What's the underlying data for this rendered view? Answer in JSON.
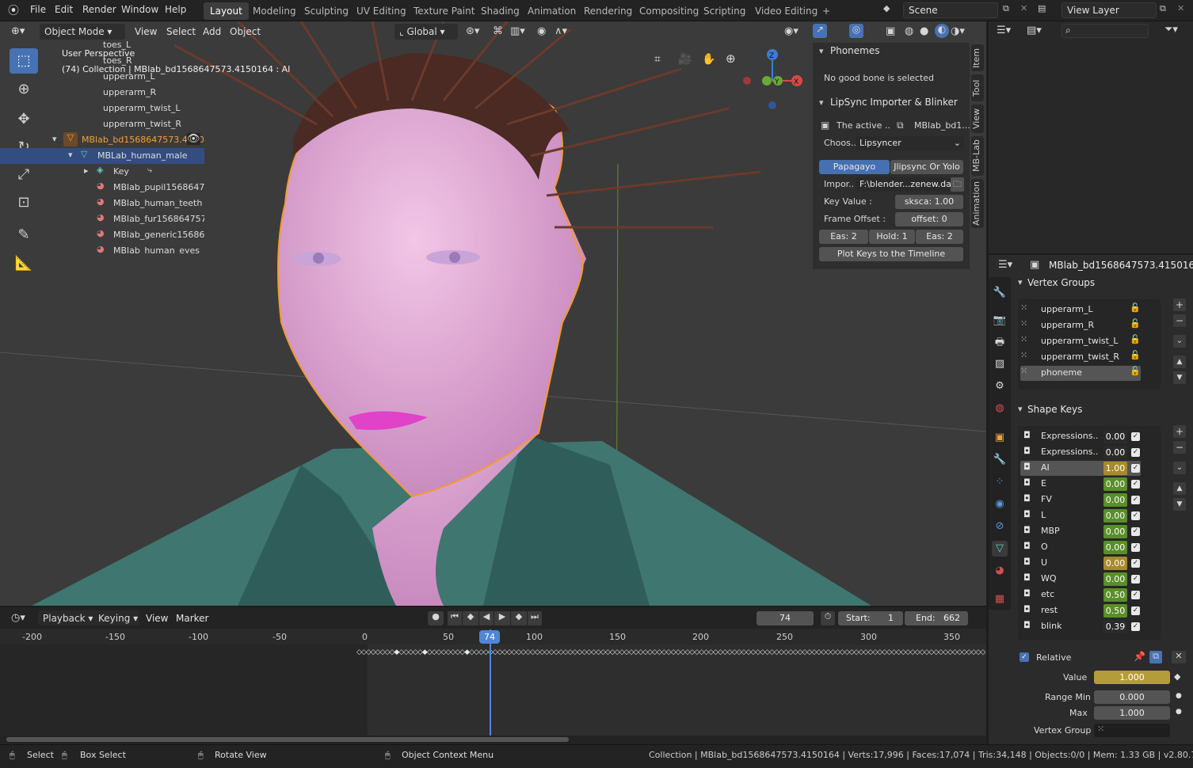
{
  "top_menu": {
    "items": [
      "File",
      "Edit",
      "Render",
      "Window",
      "Help"
    ],
    "workspaces": [
      "Layout",
      "Modeling",
      "Sculpting",
      "UV Editing",
      "Texture Paint",
      "Shading",
      "Animation",
      "Rendering",
      "Compositing",
      "Scripting",
      "Video Editing"
    ],
    "active_workspace": "Layout",
    "add_tab": "+",
    "scene": "Scene",
    "view_layer": "View Layer"
  },
  "viewport": {
    "mode": "Object Mode",
    "menus": [
      "View",
      "Select",
      "Add",
      "Object"
    ],
    "transform_orientation": "Global",
    "info_line1": "User Perspective",
    "info_line2": "(74) Collection | MBlab_bd1568647573.4150164 : AI",
    "gizmo": {
      "z": "Z",
      "y": "Y",
      "x": "X"
    }
  },
  "npanel": {
    "phonemes_title": "Phonemes",
    "phonemes_msg": "No good bone is selected",
    "lipsync_title": "LipSync Importer & Blinker",
    "active_label": "The active ..",
    "active_obj": "MBlab_bd1...",
    "choose_label": "Choos..",
    "choose_value": "Lipsyncer",
    "tab_a": "Papagayo",
    "tab_b": "Jlipsync Or Yolo",
    "import_label": "Impor..",
    "import_path": "F:\\blender...zenew.dat",
    "key_label": "Key Value :",
    "key_value": "sksca: 1.00",
    "offset_label": "Frame Offset :",
    "offset_value": "offset:      0",
    "eas1": "Eas: 2",
    "hold": "Hold: 1",
    "eas2": "Eas: 2",
    "plot_btn": "Plot Keys to the Timeline"
  },
  "side_tabs": [
    "Item",
    "Tool",
    "View",
    "MB-Lab",
    "Animation"
  ],
  "outliner": {
    "rows": [
      {
        "label": "toes_L",
        "indent": 1390
      },
      {
        "label": "toes_R",
        "indent": 1390
      },
      {
        "label": "upperarm_L",
        "indent": 1390
      },
      {
        "label": "upperarm_R",
        "indent": 1390
      },
      {
        "label": "upperarm_twist_L",
        "indent": 1390
      },
      {
        "label": "upperarm_twist_R",
        "indent": 1390
      },
      {
        "label": "MBlab_bd1568647573.4150164",
        "indent": 1350
      },
      {
        "label": "MBLab_human_male",
        "indent": 1370
      },
      {
        "label": "Key",
        "indent": 1390
      },
      {
        "label": "MBlab_pupil1568647573",
        "indent": 1390
      },
      {
        "label": "MBlab_human_teeth",
        "indent": 1390
      },
      {
        "label": "MBlab_fur1568647573",
        "indent": 1390
      },
      {
        "label": "MBlab_generic1568647573",
        "indent": 1390
      },
      {
        "label": "MBlab_human_eyes",
        "indent": 1390
      }
    ]
  },
  "properties": {
    "object_name": "MBlab_bd1568647573.4150164",
    "vertex_groups_title": "Vertex Groups",
    "vertex_groups": [
      "upperarm_L",
      "upperarm_R",
      "upperarm_twist_L",
      "upperarm_twist_R",
      "phoneme"
    ],
    "shape_keys_title": "Shape Keys",
    "shape_keys": [
      {
        "name": "Expressions..",
        "value": "0.00",
        "color": "#2b2b2b"
      },
      {
        "name": "Expressions..",
        "value": "0.00",
        "color": "#2b2b2b"
      },
      {
        "name": "AI",
        "value": "1.00",
        "color": "#a88a2a"
      },
      {
        "name": "E",
        "value": "0.00",
        "color": "#5a8f28"
      },
      {
        "name": "FV",
        "value": "0.00",
        "color": "#5a8f28"
      },
      {
        "name": "L",
        "value": "0.00",
        "color": "#5a8f28"
      },
      {
        "name": "MBP",
        "value": "0.00",
        "color": "#5a8f28"
      },
      {
        "name": "O",
        "value": "0.00",
        "color": "#5a8f28"
      },
      {
        "name": "U",
        "value": "0.00",
        "color": "#a88a2a"
      },
      {
        "name": "WQ",
        "value": "0.00",
        "color": "#5a8f28"
      },
      {
        "name": "etc",
        "value": "0.50",
        "color": "#5a8f28"
      },
      {
        "name": "rest",
        "value": "0.50",
        "color": "#5a8f28"
      },
      {
        "name": "blink",
        "value": "0.39",
        "color": "#2b2b2b"
      }
    ],
    "relative_label": "Relative",
    "value_label": "Value",
    "value": "1.000",
    "range_min_label": "Range Min",
    "range_min": "0.000",
    "max_label": "Max",
    "max": "1.000",
    "vertex_group_label": "Vertex Group"
  },
  "timeline": {
    "menus": [
      "Playback",
      "Keying",
      "View",
      "Marker"
    ],
    "current_frame": "74",
    "start_label": "Start:",
    "start": "1",
    "end_label": "End:",
    "end": "662",
    "ticks": [
      "-200",
      "-150",
      "-100",
      "-50",
      "0",
      "50",
      "100",
      "150",
      "200",
      "250",
      "300",
      "350"
    ]
  },
  "status": {
    "select": "Select",
    "box_select": "Box Select",
    "rotate": "Rotate View",
    "context": "Object Context Menu",
    "stats": "Collection | MBlab_bd1568647573.4150164 | Verts:17,996 | Faces:17,074 | Tris:34,148 | Objects:0/0 | Mem: 1.33 GB | v2.80.75"
  }
}
